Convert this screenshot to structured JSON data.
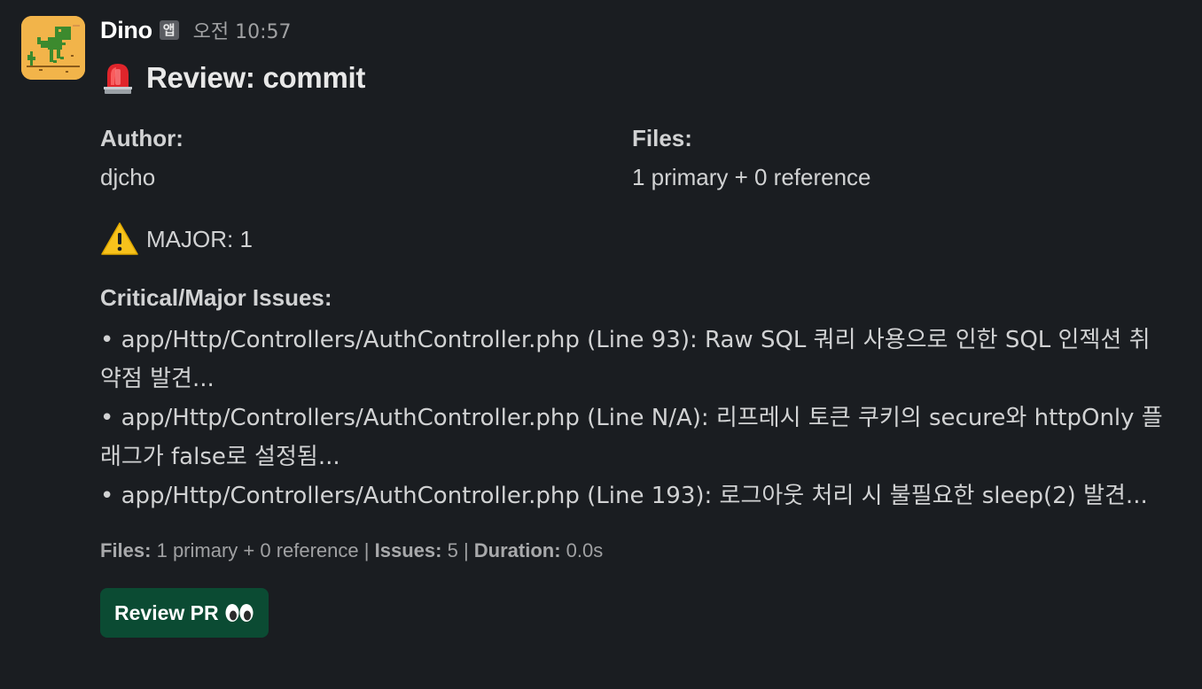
{
  "message": {
    "sender": "Dino",
    "app_badge": "앱",
    "timestamp": "오전 10:57",
    "title": "Review: commit",
    "fields": [
      {
        "label": "Author:",
        "value": "djcho"
      },
      {
        "label": "Files:",
        "value": "1 primary + 0 reference"
      }
    ],
    "severity": "MAJOR: 1",
    "issues_title": "Critical/Major Issues:",
    "issues": [
      "• app/Http/Controllers/AuthController.php (Line 93): Raw SQL 쿼리 사용으로 인한 SQL 인젝션 취약점 발견...",
      "• app/Http/Controllers/AuthController.php (Line N/A): 리프레시 토큰 쿠키의 secure와 httpOnly 플래그가 false로 설정됨...",
      "• app/Http/Controllers/AuthController.php (Line 193): 로그아웃 처리 시 불필요한 sleep(2) 발견..."
    ],
    "summary": {
      "files_label": "Files:",
      "files_value": "1 primary + 0 reference",
      "sep1": "|",
      "issues_label": "Issues:",
      "issues_value": "5",
      "sep2": "|",
      "duration_label": "Duration:",
      "duration_value": "0.0s"
    },
    "button_label": "Review PR"
  },
  "icons": {
    "avatar": "dino-avatar-icon",
    "title": "rotating-light-icon",
    "severity": "warning-icon",
    "button": "eyes-icon"
  },
  "colors": {
    "background": "#1a1d21",
    "button": "#0b4b33",
    "avatar_bg": "#f2b44a",
    "dino": "#3c8a2e"
  }
}
